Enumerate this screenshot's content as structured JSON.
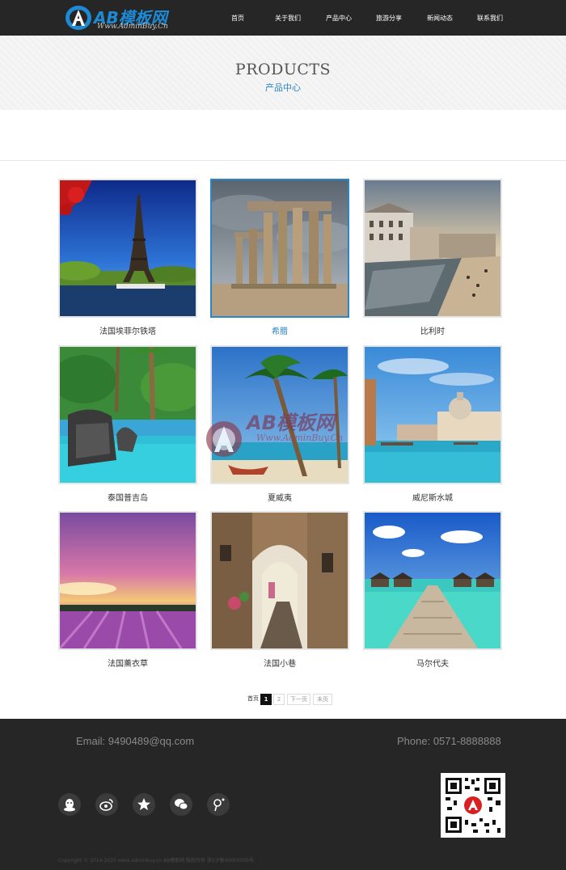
{
  "header": {
    "logo_text": "AB模板网",
    "logo_sub": "Www.AdminBuy.Cn",
    "nav": [
      {
        "label": "首页"
      },
      {
        "label": "关于我们"
      },
      {
        "label": "产品中心"
      },
      {
        "label": "旅游分享"
      },
      {
        "label": "新闻动态"
      },
      {
        "label": "联系我们"
      }
    ]
  },
  "banner": {
    "title": "PRODUCTS",
    "subtitle": "产品中心"
  },
  "products": [
    {
      "label": "法国埃菲尔铁塔",
      "image": "eiffel-tower-photo"
    },
    {
      "label": "希腊",
      "image": "greek-columns-photo",
      "active": true
    },
    {
      "label": "比利时",
      "image": "belgium-canal-photo"
    },
    {
      "label": "泰国普吉岛",
      "image": "phuket-pool-photo"
    },
    {
      "label": "夏威夷",
      "image": "hawaii-beach-photo"
    },
    {
      "label": "威尼斯水城",
      "image": "venice-photo"
    },
    {
      "label": "法国薰衣草",
      "image": "lavender-field-photo"
    },
    {
      "label": "法国小巷",
      "image": "french-alley-photo"
    },
    {
      "label": "马尔代夫",
      "image": "maldives-pier-photo"
    }
  ],
  "watermark": {
    "text": "AB模板网",
    "sub": "Www.AdminBuy.Cn"
  },
  "pagination": {
    "first": "首页",
    "pages": [
      "1",
      "2"
    ],
    "current": "1",
    "next": "下一页",
    "last": "末页"
  },
  "footer": {
    "email": "Email: 9490489@qq.com",
    "phone": "Phone: 0571-8888888",
    "social_icons": [
      "qq-icon",
      "weibo-icon",
      "star-icon",
      "wechat-icon",
      "pinterest-icon"
    ],
    "copyright": "Copyright © 2014-2020 www.adminbuy.cn AB模板网 版权所有 浙ICP备00000000号"
  },
  "colors": {
    "header_bg": "#262626",
    "accent": "#2a86c8",
    "footer_bg": "#262626"
  }
}
